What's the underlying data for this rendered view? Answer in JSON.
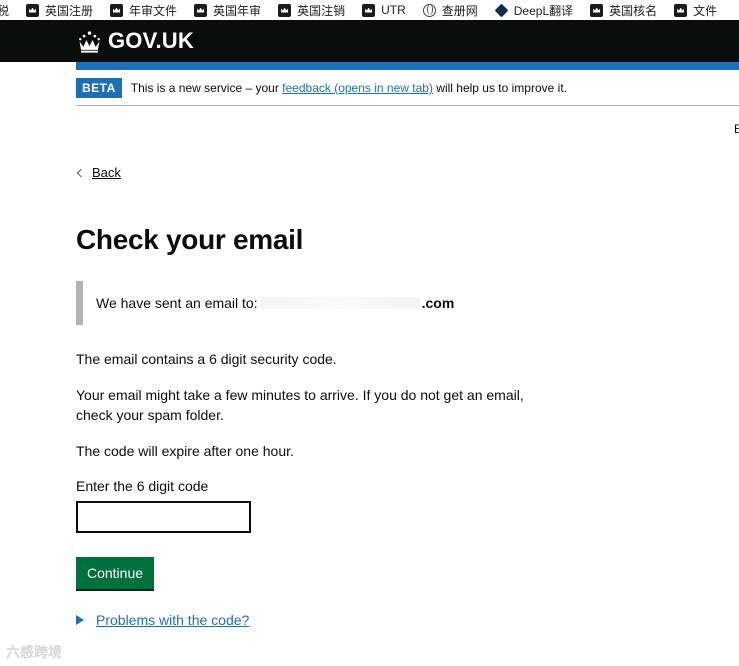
{
  "bookmarks": [
    {
      "label": "税",
      "icon": "none"
    },
    {
      "label": "英国注册",
      "icon": "crown-icon"
    },
    {
      "label": "年审文件",
      "icon": "crown-icon"
    },
    {
      "label": "英国年审",
      "icon": "crown-icon"
    },
    {
      "label": "英国注销",
      "icon": "crest-icon"
    },
    {
      "label": "UTR",
      "icon": "crown-icon"
    },
    {
      "label": "查册网",
      "icon": "globe-icon"
    },
    {
      "label": "DeepL翻译",
      "icon": "deepl-icon"
    },
    {
      "label": "英国核名",
      "icon": "crown-icon"
    },
    {
      "label": "文件",
      "icon": "crest-icon"
    }
  ],
  "header": {
    "logo_text": "GOV.UK"
  },
  "phase_banner": {
    "tag": "BETA",
    "text_before": "This is a new service – your ",
    "link": "feedback (opens in new tab)",
    "text_after": " will help us to improve it."
  },
  "edge_char": "E",
  "back_link": "Back",
  "page_title": "Check your email",
  "inset": {
    "text": "We have sent an email to:",
    "domain": ".com"
  },
  "paragraphs": {
    "p1": "The email contains a 6 digit security code.",
    "p2": "Your email might take a few minutes to arrive. If you do not get an email, check your spam folder.",
    "p3": "The code will expire after one hour."
  },
  "code_field": {
    "label": "Enter the 6 digit code",
    "value": ""
  },
  "continue_button": "Continue",
  "details_summary": "Problems with the code?",
  "watermark": "六感跨境",
  "colors": {
    "header_bg": "#0b0c0c",
    "brand_blue": "#1d70b8",
    "button_green": "#00703c",
    "inset_border": "#b1b4b6"
  }
}
